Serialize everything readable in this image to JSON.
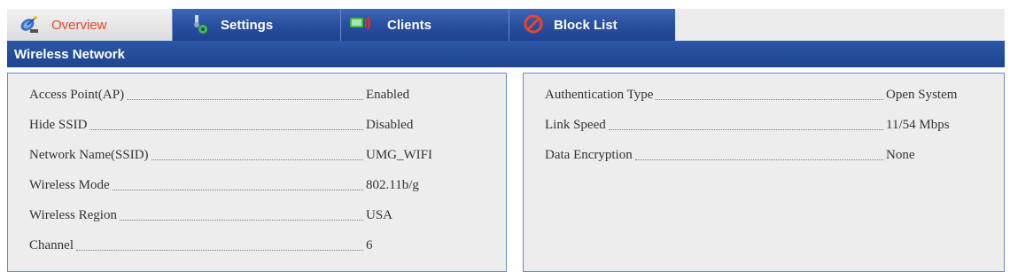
{
  "tabs": [
    {
      "label": "Overview",
      "icon": "satellite-dish-icon"
    },
    {
      "label": "Settings",
      "icon": "settings-icon"
    },
    {
      "label": "Clients",
      "icon": "clients-icon"
    },
    {
      "label": "Block List",
      "icon": "block-icon"
    }
  ],
  "section": {
    "title": "Wireless Network"
  },
  "left_panel": [
    {
      "label": "Access Point(AP)",
      "value": "Enabled"
    },
    {
      "label": "Hide SSID",
      "value": "Disabled"
    },
    {
      "label": "Network Name(SSID)",
      "value": "UMG_WIFI"
    },
    {
      "label": "Wireless Mode",
      "value": "802.11b/g"
    },
    {
      "label": "Wireless Region",
      "value": "USA"
    },
    {
      "label": "Channel",
      "value": "6"
    }
  ],
  "right_panel": [
    {
      "label": "Authentication Type",
      "value": "Open System"
    },
    {
      "label": "Link Speed",
      "value": "11/54 Mbps"
    },
    {
      "label": "Data Encryption",
      "value": "None"
    }
  ],
  "colors": {
    "tab_blue": "#2a4f9f",
    "active_tab_text": "#e8462a",
    "header_blue": "#1e4590",
    "panel_bg": "#ededed",
    "panel_border": "#6d8ab8"
  }
}
